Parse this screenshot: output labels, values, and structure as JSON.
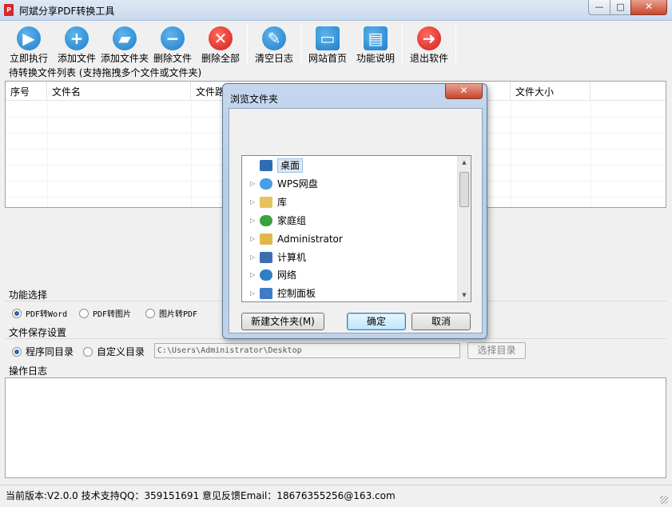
{
  "window": {
    "title": "阿斌分享PDF转换工具",
    "min": "—",
    "max": "□",
    "close": "✕"
  },
  "toolbar": [
    {
      "label": "立即执行",
      "icon": "play-icon",
      "glyph": "▶",
      "color": "blue"
    },
    {
      "label": "添加文件",
      "icon": "plus-icon",
      "glyph": "+",
      "color": "blue"
    },
    {
      "label": "添加文件夹",
      "icon": "folder-icon",
      "glyph": "▰",
      "color": "blue"
    },
    {
      "label": "删除文件",
      "icon": "minus-icon",
      "glyph": "−",
      "color": "blue"
    },
    {
      "label": "删除全部",
      "icon": "close-icon",
      "glyph": "✕",
      "color": "red"
    },
    {
      "label": "清空日志",
      "icon": "broom-icon",
      "glyph": "✎",
      "color": "blue"
    },
    {
      "label": "网站首页",
      "icon": "monitor-icon",
      "glyph": "▭",
      "color": "blue"
    },
    {
      "label": "功能说明",
      "icon": "document-icon",
      "glyph": "▤",
      "color": "blue"
    },
    {
      "label": "退出软件",
      "icon": "exit-icon",
      "glyph": "➜",
      "color": "red"
    }
  ],
  "file_list": {
    "label": "待转换文件列表 (支持拖拽多个文件或文件夹)",
    "columns": [
      "序号",
      "文件名",
      "文件路",
      "文件大小"
    ]
  },
  "function": {
    "label": "功能选择",
    "options": [
      "PDF转Word",
      "PDF转图片",
      "图片转PDF"
    ],
    "selected": "PDF转Word"
  },
  "save": {
    "label": "文件保存设置",
    "options": [
      "程序同目录",
      "自定义目录"
    ],
    "selected": "程序同目录",
    "path": "C:\\Users\\Administrator\\Desktop",
    "choose_label": "选择目录"
  },
  "log": {
    "label": "操作日志"
  },
  "status": {
    "text": "当前版本:V2.0.0   技术支持QQ：359151691   意见反馈Email：18676355256@163.com"
  },
  "dialog": {
    "title": "浏览文件夹",
    "close": "✕",
    "tree": [
      {
        "label": "桌面",
        "icon": "desktop-icon",
        "color": "#2e6db5",
        "selected": true
      },
      {
        "label": "WPS网盘",
        "icon": "cloud-icon",
        "color": "#4a9ee8",
        "selected": false
      },
      {
        "label": "库",
        "icon": "library-icon",
        "color": "#e6c35a",
        "selected": false
      },
      {
        "label": "家庭组",
        "icon": "homegroup-icon",
        "color": "#3aa33a",
        "selected": false
      },
      {
        "label": "Administrator",
        "icon": "user-folder-icon",
        "color": "#e2b84a",
        "selected": false
      },
      {
        "label": "计算机",
        "icon": "computer-icon",
        "color": "#3d6fb0",
        "selected": false
      },
      {
        "label": "网络",
        "icon": "network-icon",
        "color": "#2f7fc5",
        "selected": false
      },
      {
        "label": "控制面板",
        "icon": "control-panel-icon",
        "color": "#3e7cc8",
        "selected": false
      }
    ],
    "buttons": {
      "new_folder": "新建文件夹(M)",
      "ok": "确定",
      "cancel": "取消"
    }
  }
}
